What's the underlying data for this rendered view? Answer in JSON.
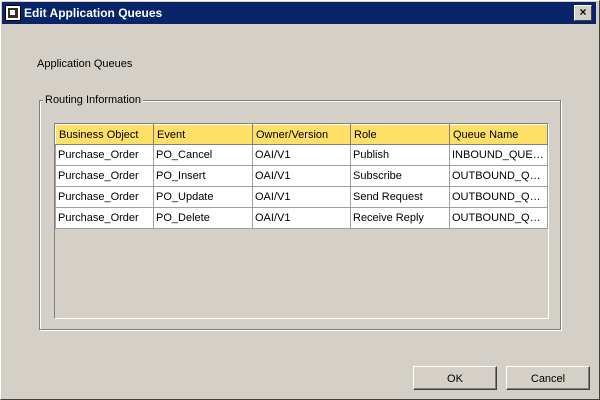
{
  "window": {
    "title": "Edit Application Queues",
    "close_label": "×"
  },
  "section_label": "Application Queues",
  "group": {
    "legend": "Routing Information"
  },
  "table": {
    "columns": [
      "Business Object",
      "Event",
      "Owner/Version",
      "Role",
      "Queue Name"
    ],
    "rows": [
      [
        "Purchase_Order",
        "PO_Cancel",
        "OAI/V1",
        "Publish",
        "INBOUND_QUEUE"
      ],
      [
        "Purchase_Order",
        "PO_Insert",
        "OAI/V1",
        "Subscribe",
        "OUTBOUND_QUE..."
      ],
      [
        "Purchase_Order",
        "PO_Update",
        "OAI/V1",
        "Send Request",
        "OUTBOUND_QUE..."
      ],
      [
        "Purchase_Order",
        "PO_Delete",
        "OAI/V1",
        "Receive Reply",
        "OUTBOUND_QUE..."
      ]
    ]
  },
  "buttons": {
    "ok": "OK",
    "cancel": "Cancel"
  },
  "colors": {
    "titlebar": "#0a246a",
    "header": "#ffe066",
    "window_bg": "#d4d0c8"
  }
}
